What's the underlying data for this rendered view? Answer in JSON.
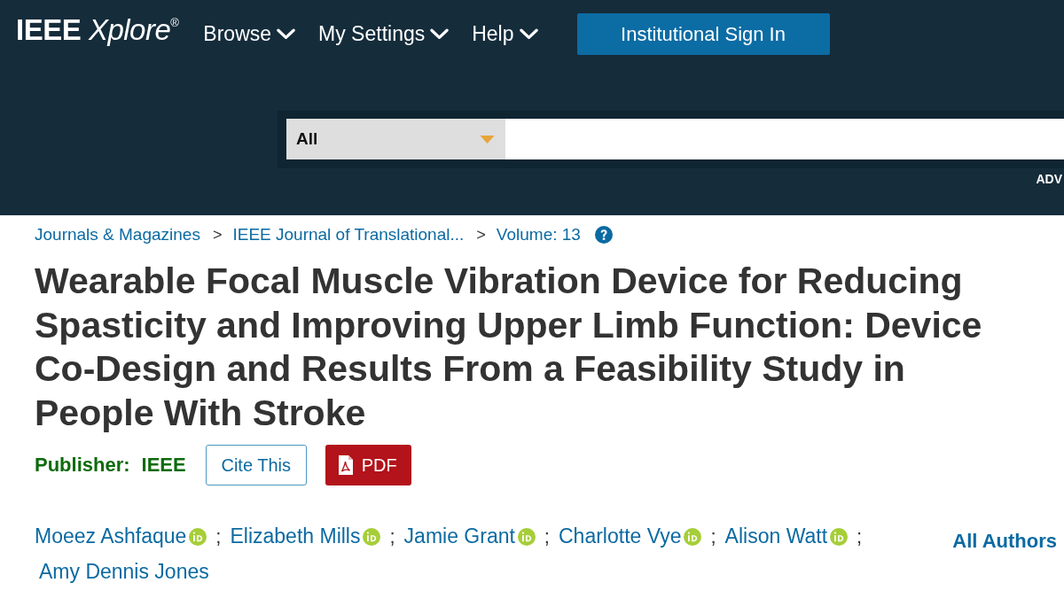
{
  "header": {
    "logo": "**IEEE** *Xplore*$^{®}$",
    "nav": [
      {
        "label": "Browse"
      },
      {
        "label": "My Settings"
      },
      {
        "label": "Help"
      }
    ],
    "sign_in_button": "Institutional Sign In",
    "search": {
      "scope": "All",
      "advanced_link": "ADV"
    }
  },
  "breadcrumb": [
    {
      "label": "Journals & Magazines",
      "separator": ">"
    },
    {
      "label": "IEEE Journal of Translational...",
      "separator": ">"
    },
    {
      "label": "Volume: 13"
    }
  ],
  "article": {
    "title": "Wearable Focal Muscle Vibration Device for Reducing Spasticity and Improving Upper Limb Function: Device Co-Design and Results From a Feasibility Study in People With Stroke",
    "publisher_label": "Publisher:",
    "publisher": "IEEE",
    "buttons": [
      {
        "kind": "outline",
        "label": "Cite This"
      },
      {
        "kind": "pdf",
        "label": "PDF"
      }
    ],
    "authors": [
      {
        "name": "Moeez Ashfaque",
        "orcid": true,
        "separator": ";"
      },
      {
        "name": "Elizabeth Mills",
        "orcid": true,
        "separator": ";"
      },
      {
        "name": "Jamie Grant",
        "orcid": true,
        "separator": ";"
      },
      {
        "name": "Charlotte Vye",
        "orcid": true,
        "separator": ";"
      },
      {
        "name": "Alison Watt",
        "orcid": true,
        "separator": ";"
      },
      {
        "name": "Amy Dennis Jones",
        "orcid": false
      }
    ],
    "all_authors_link": "All Authors"
  }
}
